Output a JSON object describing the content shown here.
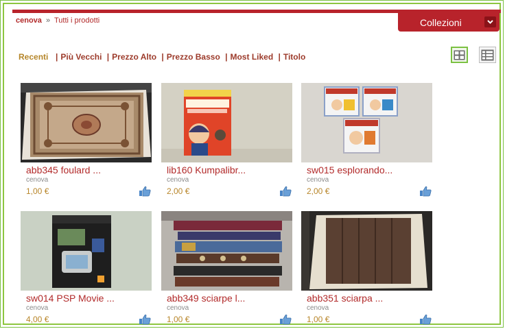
{
  "breadcrumb": {
    "home": "cenova",
    "separator": "»",
    "current": "Tutti i prodotti"
  },
  "collections_button": {
    "label": "Collezioni",
    "icon": "chevron-down-icon"
  },
  "sort_options": [
    {
      "label": "Recenti",
      "active": true
    },
    {
      "label": "Più Vecchi",
      "active": false
    },
    {
      "label": "Prezzo Alto",
      "active": false
    },
    {
      "label": "Prezzo Basso",
      "active": false
    },
    {
      "label": "Most Liked",
      "active": false
    },
    {
      "label": "Titolo",
      "active": false
    }
  ],
  "view_toggle": {
    "selected": "grid",
    "options": [
      "grid-view-icon",
      "list-view-icon"
    ]
  },
  "products": [
    {
      "title": "abb345 foulard ...",
      "seller": "cenova",
      "price": "1,00 €",
      "icon": "like-icon"
    },
    {
      "title": "lib160 Kumpalibr...",
      "seller": "cenova",
      "price": "2,00 €",
      "icon": "like-icon"
    },
    {
      "title": "sw015 esplorando...",
      "seller": "cenova",
      "price": "2,00 €",
      "icon": "like-icon"
    },
    {
      "title": "sw014 PSP Movie ...",
      "seller": "cenova",
      "price": "4,00 €",
      "icon": "like-icon"
    },
    {
      "title": "abb349 sciarpe l...",
      "seller": "cenova",
      "price": "1,00 €",
      "icon": "like-icon"
    },
    {
      "title": "abb351 sciarpa ...",
      "seller": "cenova",
      "price": "1,00 €",
      "icon": "like-icon"
    }
  ],
  "colors": {
    "brand_red": "#b8232b",
    "link_red": "#b22a2a",
    "price_gold": "#b8862a",
    "frame_green": "#8dc63f"
  }
}
